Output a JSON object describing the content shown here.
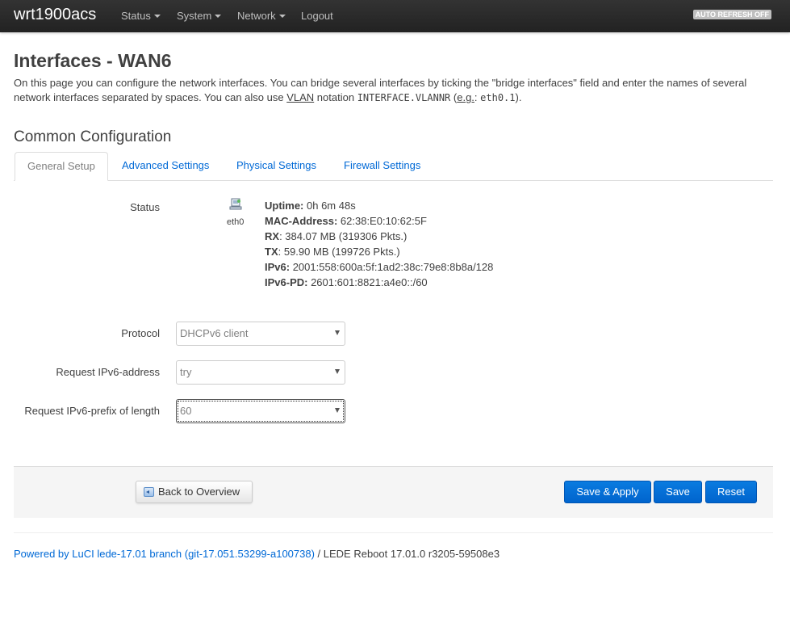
{
  "topbar": {
    "brand": "wrt1900acs",
    "menu": [
      "Status",
      "System",
      "Network",
      "Logout"
    ],
    "autorefresh": "AUTO REFRESH OFF"
  },
  "page": {
    "title": "Interfaces - WAN6",
    "desc_1": "On this page you can configure the network interfaces. You can bridge several interfaces by ticking the \"bridge interfaces\" field and enter the names of several network interfaces separated by spaces. You can also use ",
    "desc_vlan": "VLAN",
    "desc_2": " notation ",
    "desc_code1": "INTERFACE.VLANNR",
    "desc_3": " (",
    "desc_eg": "e.g.",
    "desc_4": ": ",
    "desc_code2": "eth0.1",
    "desc_5": ")."
  },
  "section": {
    "title": "Common Configuration",
    "tabs": [
      "General Setup",
      "Advanced Settings",
      "Physical Settings",
      "Firewall Settings"
    ]
  },
  "status": {
    "label": "Status",
    "icon": "ethernet-port-icon",
    "ifname": "eth0",
    "uptime_k": "Uptime:",
    "uptime_v": " 0h 6m 48s",
    "mac_k": "MAC-Address:",
    "mac_v": " 62:38:E0:10:62:5F",
    "rx_k": "RX",
    "rx_v": ": 384.07 MB (319306 Pkts.)",
    "tx_k": "TX",
    "tx_v": ": 59.90 MB (199726 Pkts.)",
    "ipv6_k": "IPv6:",
    "ipv6_v": " 2001:558:600a:5f:1ad2:38c:79e8:8b8a/128",
    "ipv6pd_k": "IPv6-PD:",
    "ipv6pd_v": " 2601:601:8821:a4e0::/60"
  },
  "fields": {
    "protocol_label": "Protocol",
    "protocol_value": "DHCPv6 client",
    "reqaddr_label": "Request IPv6-address",
    "reqaddr_value": "try",
    "reqprefix_label": "Request IPv6-prefix of length",
    "reqprefix_value": "60"
  },
  "actions": {
    "back": "Back to Overview",
    "save_apply": "Save & Apply",
    "save": "Save",
    "reset": "Reset"
  },
  "footer": {
    "link": "Powered by LuCI lede-17.01 branch (git-17.051.53299-a100738)",
    "rest": " / LEDE Reboot 17.01.0 r3205-59508e3"
  },
  "colors": {
    "accent": "#0069d6",
    "topbar": "#222222",
    "button_primary": "#0064cd"
  }
}
